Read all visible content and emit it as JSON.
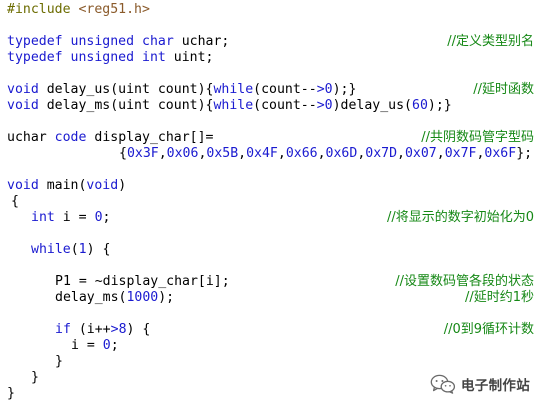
{
  "code": {
    "include_directive": "#include",
    "include_file": "<reg51.h>",
    "typedef_uchar": {
      "kw1": "typedef",
      "kw2": "unsigned",
      "kw3": "char",
      "rest": "uchar;",
      "comment": "//定义类型别名"
    },
    "typedef_uint": {
      "kw1": "typedef",
      "kw2": "unsigned",
      "kw3": "int",
      "rest": "uint;"
    },
    "delay_us_line": {
      "kw_void": "void",
      "sig": "delay_us(uint count){",
      "kw_while": "while",
      "cond_open": "(count--",
      "gt": ">",
      "num": "0",
      "tail": ");}",
      "comment": "//延时函数"
    },
    "delay_ms_line": {
      "kw_void": "void",
      "sig": "delay_ms(uint count){",
      "kw_while": "while",
      "cond_open": "(count--",
      "gt": ">",
      "num": "0",
      "mid": ")delay_us(",
      "arg": "60",
      "tail": ");}"
    },
    "array_decl": {
      "kw_uchar": "uchar",
      "kw_code": "code",
      "rest": "display_char[]=",
      "comment": "//共阴数码管字型码"
    },
    "array_values": {
      "open": "{",
      "values": [
        "0x3F",
        "0x06",
        "0x5B",
        "0x4F",
        "0x66",
        "0x6D",
        "0x7D",
        "0x07",
        "0x7F",
        "0x6F"
      ],
      "sep": ",",
      "close": "};"
    },
    "main_decl": {
      "kw_void": "void",
      "name": "main(",
      "kw_void2": "void",
      "close": ")"
    },
    "brace_open": "{",
    "int_line": {
      "kw_int": "int",
      "rest": "i =",
      "num": "0",
      "semi": ";",
      "comment": "//将显示的数字初始化为0"
    },
    "while_line": {
      "kw_while": "while",
      "open": "(",
      "num": "1",
      "close": ") {"
    },
    "p1_line": {
      "text": "P1 = ~display_char[i];",
      "comment": "//设置数码管各段的状态"
    },
    "delay_call_line": {
      "fn": "delay_ms(",
      "num": "1000",
      "close": ");",
      "comment": "//延时约1秒"
    },
    "if_line": {
      "kw_if": "if",
      "cond_a": "(i++",
      "gt": ">",
      "num": "8",
      "close": ") {",
      "comment": "//0到9循环计数"
    },
    "reset_line": {
      "lhs": "i =",
      "num": "0",
      "semi": ";"
    },
    "inner_close": "}",
    "outer_close": "}",
    "main_close": "}"
  },
  "watermark": {
    "icon": "wechat-icon",
    "text": "电子制作站"
  },
  "colors": {
    "keyword": "#1a1ad0",
    "preprocessor": "#6c6c00",
    "include_file": "#8a5a2a",
    "comment": "#158815",
    "text": "#000000",
    "background": "#ffffff"
  }
}
